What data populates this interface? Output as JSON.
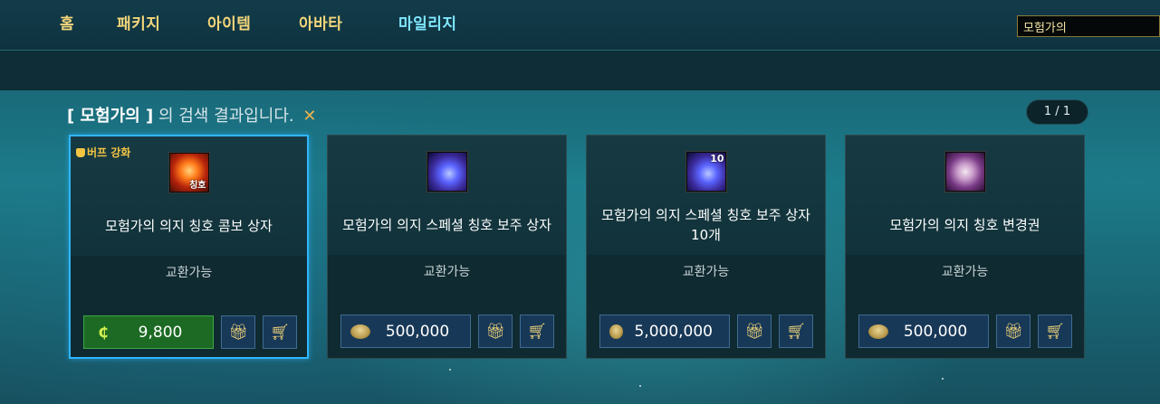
{
  "nav": {
    "items": [
      {
        "label": "홈",
        "active": false
      },
      {
        "label": "패키지",
        "active": false
      },
      {
        "label": "아이템",
        "active": false
      },
      {
        "label": "아바타",
        "active": false
      },
      {
        "label": "마일리지",
        "active": true
      }
    ],
    "search_value": "모험가의"
  },
  "results": {
    "keyword": "[ 모험가의 ]",
    "suffix": "의 검색 결과입니다.",
    "clear_icon": "close-icon",
    "pager": "1 / 1"
  },
  "cards": [
    {
      "badge": "버프 강화",
      "icon": "title-combo-box-icon",
      "icon_text": "칭호",
      "name": "모험가의 의지 칭호 콤보 상자",
      "trade": "교환가능",
      "currency": "cash",
      "price": "9,800",
      "selected": true
    },
    {
      "badge": "",
      "icon": "special-title-box-icon",
      "icon_text": "",
      "name": "모험가의 의지 스페셜 칭호 보주 상자",
      "trade": "교환가능",
      "currency": "mileage",
      "price": "500,000",
      "selected": false
    },
    {
      "badge": "",
      "icon": "special-title-box-10-icon",
      "icon_text": "10",
      "name": "모험가의 의지 스페셜 칭호 보주 상자 10개",
      "trade": "교환가능",
      "currency": "mileage",
      "price": "5,000,000",
      "selected": false
    },
    {
      "badge": "",
      "icon": "title-change-ticket-icon",
      "icon_text": "",
      "name": "모험가의 의지 칭호 변경권",
      "trade": "교환가능",
      "currency": "mileage",
      "price": "500,000",
      "selected": false
    }
  ],
  "colors": {
    "accent_gold": "#f3d67a",
    "active_nav": "#7fe6ff",
    "selected_border": "#2fb6ff",
    "cash_green": "#1c6a23"
  }
}
